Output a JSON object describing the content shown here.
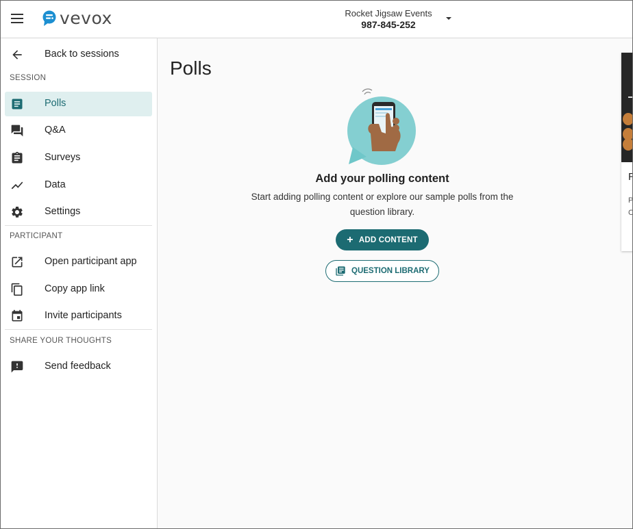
{
  "app": {
    "logo_text": "vevox"
  },
  "header": {
    "event_name": "Rocket Jigsaw Events",
    "event_code": "987-845-252"
  },
  "sidebar": {
    "back_label": "Back to sessions",
    "sections": {
      "session": "SESSION",
      "participant": "PARTICIPANT",
      "share": "SHARE YOUR THOUGHTS"
    },
    "items": {
      "polls": "Polls",
      "qa": "Q&A",
      "surveys": "Surveys",
      "data": "Data",
      "settings": "Settings",
      "open_app": "Open participant app",
      "copy_link": "Copy app link",
      "invite": "Invite participants",
      "feedback": "Send feedback"
    }
  },
  "main": {
    "title": "Polls",
    "empty_title": "Add your polling content",
    "empty_text": "Start adding polling content or explore our sample polls from the question library.",
    "add_button": "ADD CONTENT",
    "library_button": "QUESTION LIBRARY"
  },
  "side_card": {
    "title": "R",
    "line1": "P",
    "line2": "C"
  },
  "colors": {
    "accent": "#1c6b72",
    "active_bg": "#dfefef",
    "logo_blue": "#1d8fd1"
  }
}
